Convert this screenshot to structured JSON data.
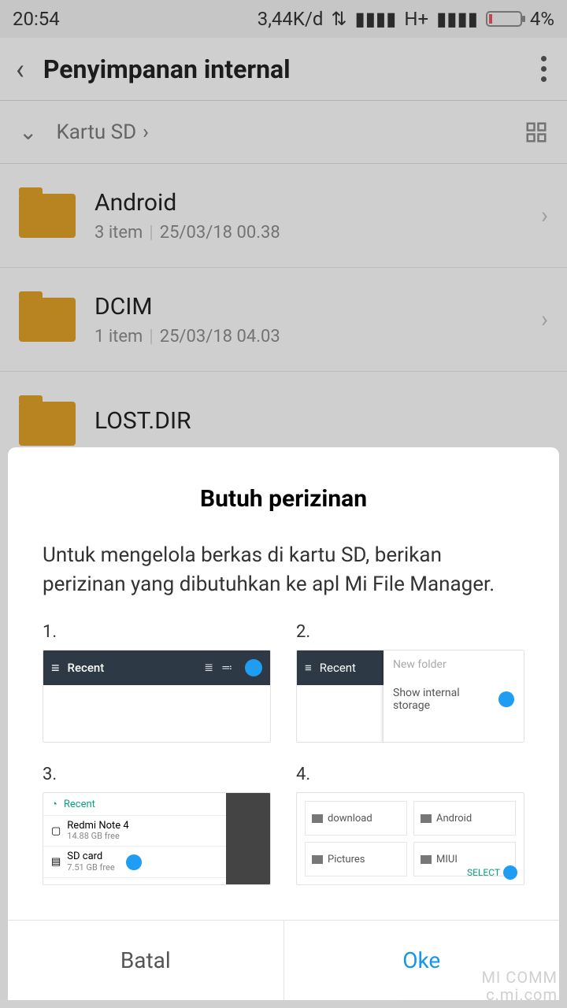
{
  "status": {
    "time": "20:54",
    "net_speed": "3,44K/d",
    "net_type": "H+",
    "battery": "4%"
  },
  "appbar": {
    "title": "Penyimpanan internal"
  },
  "pathbar": {
    "label": "Kartu SD"
  },
  "folders": [
    {
      "name": "Android",
      "count": "3 item",
      "date": "25/03/18 00.38"
    },
    {
      "name": "DCIM",
      "count": "1 item",
      "date": "25/03/18 04.03"
    },
    {
      "name": "LOST.DIR",
      "count": "",
      "date": ""
    }
  ],
  "dialog": {
    "title": "Butuh perizinan",
    "body": "Untuk mengelola berkas di kartu SD, berikan perizinan yang dibutuhkan ke apl Mi File Manager.",
    "steps": {
      "s1": {
        "num": "1.",
        "recent": "Recent"
      },
      "s2": {
        "num": "2.",
        "recent": "Recent",
        "menu1": "New folder",
        "menu2": "Show internal storage"
      },
      "s3": {
        "num": "3.",
        "recent": "Recent",
        "dev": "Redmi Note 4",
        "dev_sub": "14.88 GB free",
        "sd": "SD card",
        "sd_sub": "7.51 GB free"
      },
      "s4": {
        "num": "4.",
        "t1": "download",
        "t2": "Android",
        "t3": "Pictures",
        "t4": "MIUI",
        "select": "SELECT"
      }
    },
    "cancel": "Batal",
    "ok": "Oke"
  },
  "watermark": {
    "l1": "MI COMM",
    "l2": "c.mi.com"
  }
}
